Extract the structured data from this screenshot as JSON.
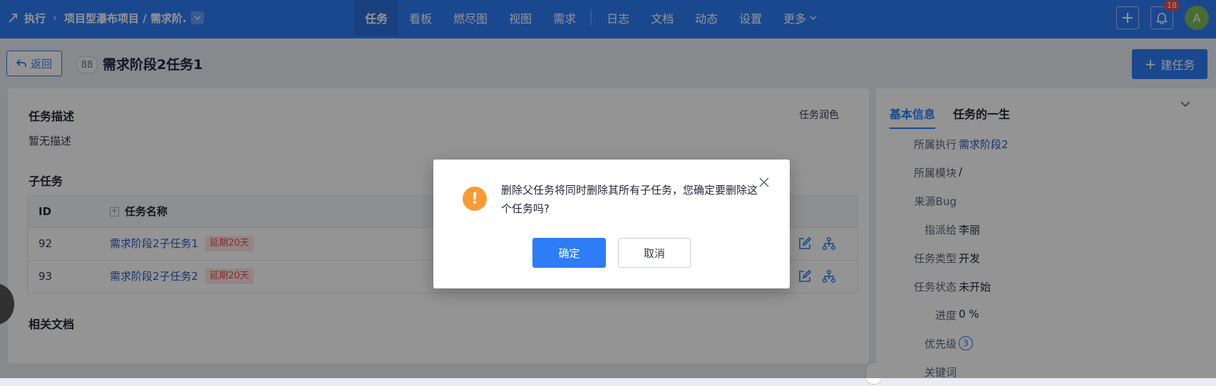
{
  "nav": {
    "breadcrumb_root": "执行",
    "breadcrumb_project": "项目型瀑布项目 / 需求阶.",
    "menu": [
      {
        "label": "任务",
        "active": true
      },
      {
        "label": "看板"
      },
      {
        "label": "燃尽图"
      },
      {
        "label": "视图"
      },
      {
        "label": "需求"
      },
      {
        "label": "日志"
      },
      {
        "label": "文档"
      },
      {
        "label": "动态"
      },
      {
        "label": "设置"
      },
      {
        "label": "更多"
      }
    ],
    "notification_count": "18",
    "avatar_initial": "A"
  },
  "header": {
    "back_label": "返回",
    "task_id": "88",
    "task_title": "需求阶段2任务1",
    "new_task_label": "建任务"
  },
  "main": {
    "desc_title": "任务描述",
    "desc_text": "暂无描述",
    "polish_label": "任务润色",
    "subtasks_title": "子任务",
    "table": {
      "col_id": "ID",
      "col_name": "任务名称",
      "rows": [
        {
          "id": "92",
          "name": "需求阶段2子任务1",
          "delay": "延期20天"
        },
        {
          "id": "93",
          "name": "需求阶段2子任务2",
          "delay": "延期20天"
        }
      ]
    },
    "docs_title": "相关文档"
  },
  "side": {
    "tab_basic": "基本信息",
    "tab_life": "任务的一生",
    "fields": [
      {
        "k": "所属执行",
        "v": "需求阶段2",
        "link": true
      },
      {
        "k": "所属模块",
        "v": "/"
      },
      {
        "k": "来源Bug",
        "v": ""
      },
      {
        "k": "指派给",
        "v": "李丽"
      },
      {
        "k": "任务类型",
        "v": "开发"
      },
      {
        "k": "任务状态",
        "v": "未开始"
      },
      {
        "k": "进度",
        "v": "0 %"
      },
      {
        "k": "优先级",
        "v": "3"
      },
      {
        "k": "关键词",
        "v": ""
      }
    ]
  },
  "dialog": {
    "message": "删除父任务将同时删除其所有子任务，您确定要删除这个任务吗?",
    "confirm_label": "确定",
    "cancel_label": "取消"
  },
  "colors": {
    "primary": "#2e7cf6",
    "warning": "#f89b37",
    "danger": "#e34d4d"
  }
}
